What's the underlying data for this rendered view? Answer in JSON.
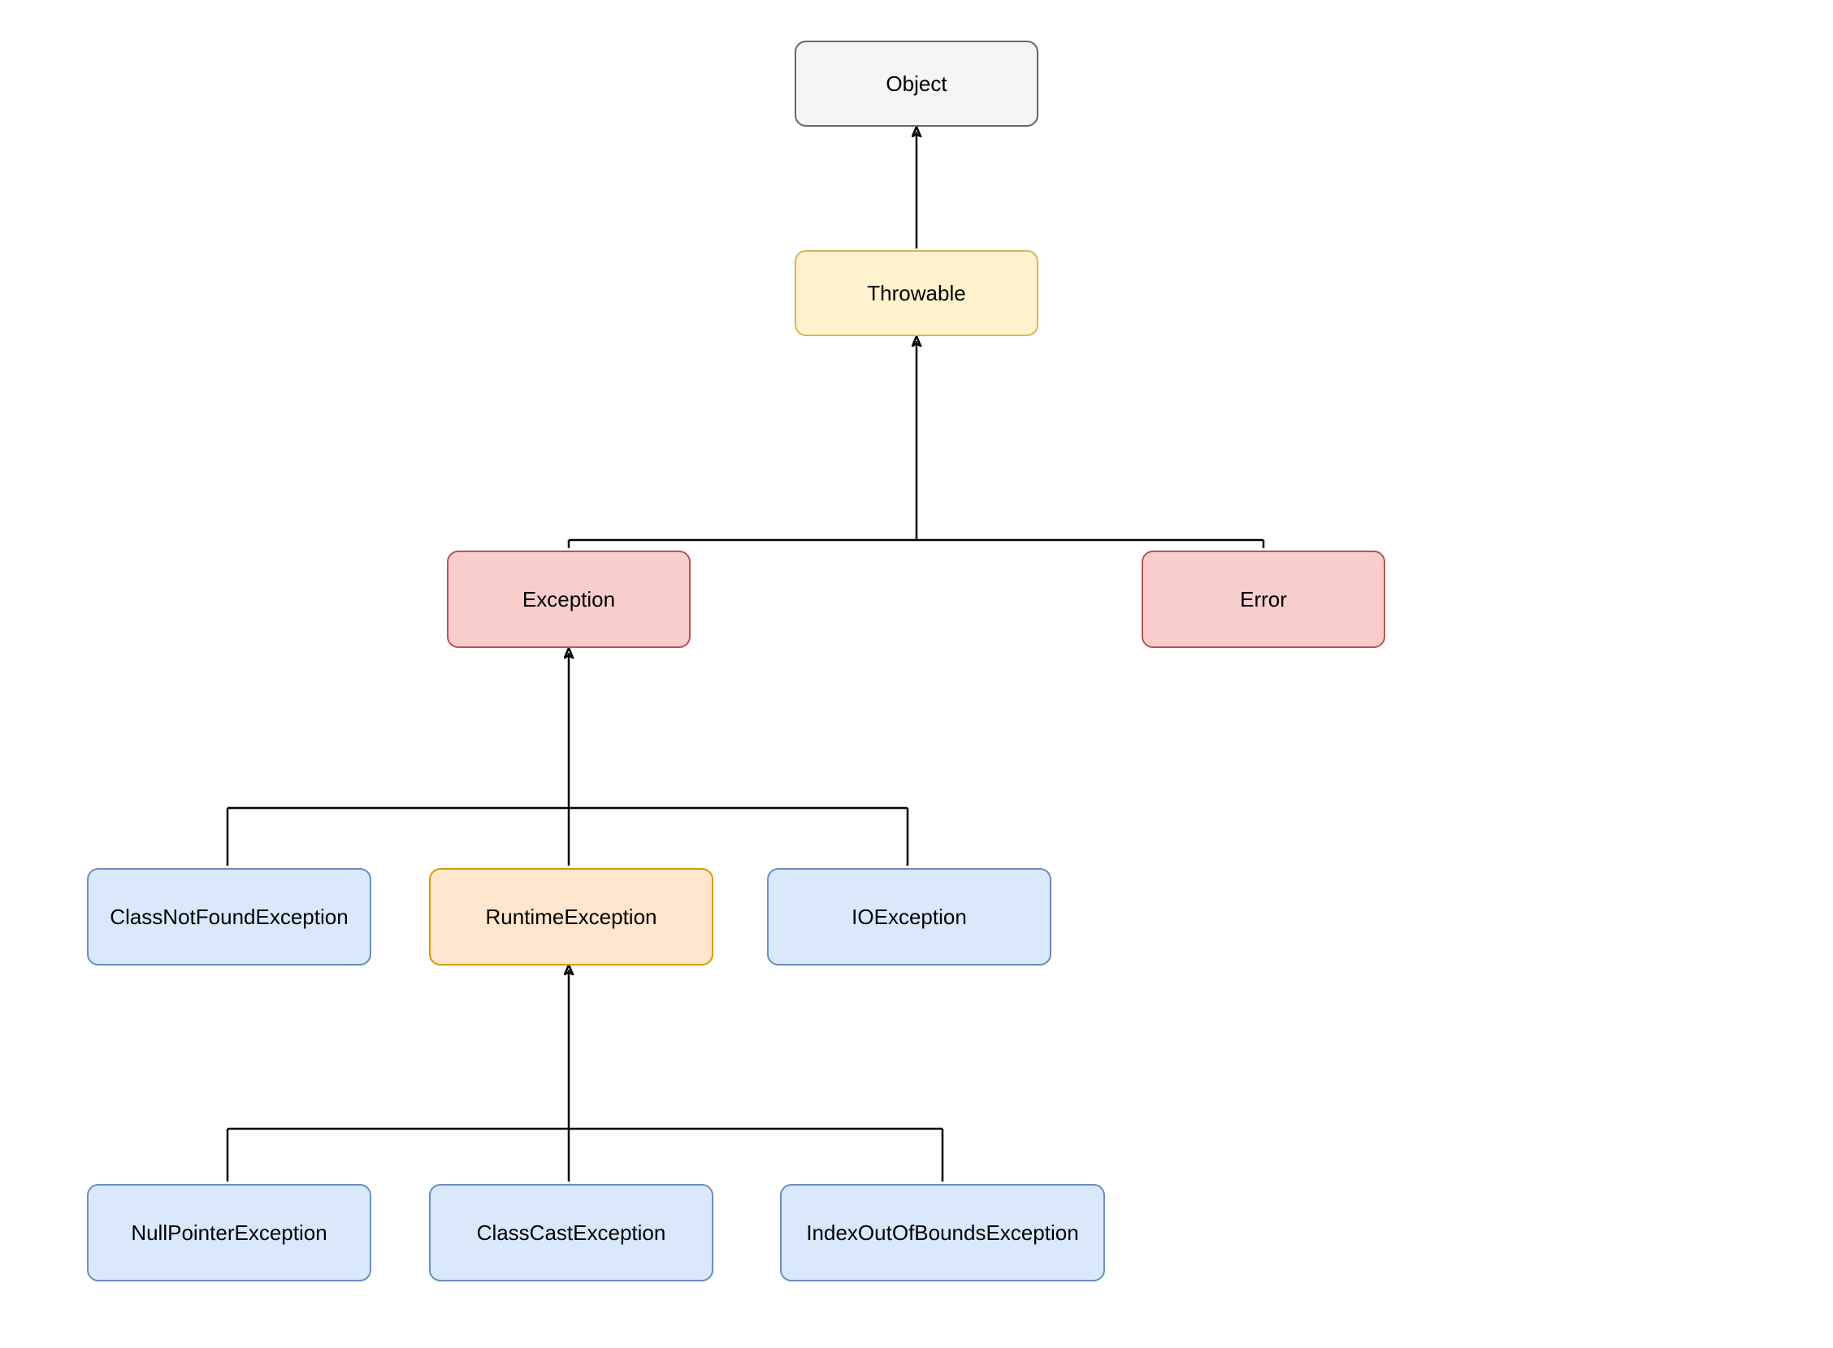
{
  "nodes": {
    "object": {
      "label": "Object",
      "color": "gray"
    },
    "throwable": {
      "label": "Throwable",
      "color": "yellow"
    },
    "exception": {
      "label": "Exception",
      "color": "red"
    },
    "error": {
      "label": "Error",
      "color": "red"
    },
    "classNotFound": {
      "label": "ClassNotFoundException",
      "color": "blue"
    },
    "runtime": {
      "label": "RuntimeException",
      "color": "orange"
    },
    "io": {
      "label": "IOException",
      "color": "blue"
    },
    "nullPointer": {
      "label": "NullPointerException",
      "color": "blue"
    },
    "classCast": {
      "label": "ClassCastException",
      "color": "blue"
    },
    "indexOob": {
      "label": "IndexOutOfBoundsException",
      "color": "blue"
    }
  },
  "edges": [
    {
      "from": "throwable",
      "to": "object"
    },
    {
      "from": "exception",
      "to": "throwable"
    },
    {
      "from": "error",
      "to": "throwable"
    },
    {
      "from": "classNotFound",
      "to": "exception"
    },
    {
      "from": "runtime",
      "to": "exception"
    },
    {
      "from": "io",
      "to": "exception"
    },
    {
      "from": "nullPointer",
      "to": "runtime"
    },
    {
      "from": "classCast",
      "to": "runtime"
    },
    {
      "from": "indexOob",
      "to": "runtime"
    }
  ],
  "hierarchy": {
    "root": "object",
    "structure": {
      "object": [
        "throwable"
      ],
      "throwable": [
        "exception",
        "error"
      ],
      "exception": [
        "classNotFound",
        "runtime",
        "io"
      ],
      "runtime": [
        "nullPointer",
        "classCast",
        "indexOob"
      ]
    }
  }
}
